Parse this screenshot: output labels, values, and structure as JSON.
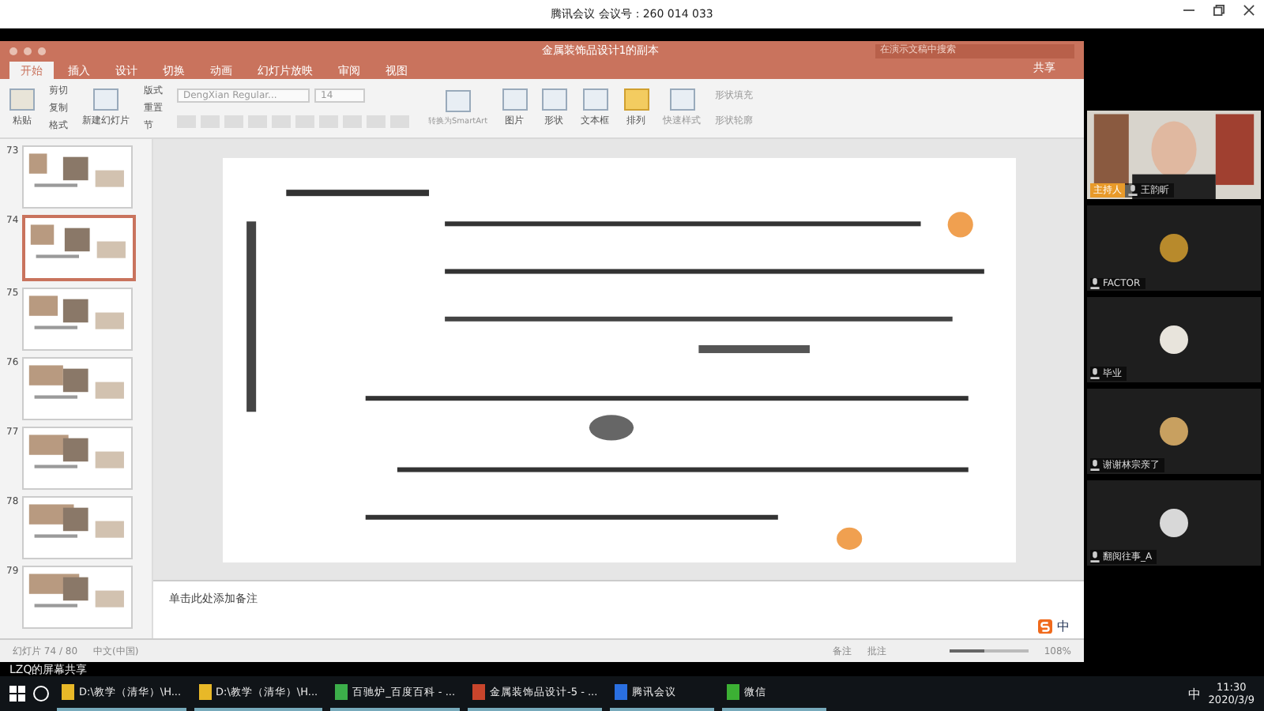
{
  "meeting_bar": {
    "title": "腾讯会议 会议号：260 014 033"
  },
  "ppt": {
    "title": "金属装饰品设计1的副本",
    "search": {
      "placeholder": "在演示文稿中搜索"
    },
    "share": "共享",
    "tabs": [
      {
        "label": "开始",
        "selected": true
      },
      {
        "label": "插入",
        "selected": false
      },
      {
        "label": "设计",
        "selected": false
      },
      {
        "label": "切换",
        "selected": false
      },
      {
        "label": "动画",
        "selected": false
      },
      {
        "label": "幻灯片放映",
        "selected": false
      },
      {
        "label": "审阅",
        "selected": false
      },
      {
        "label": "视图",
        "selected": false
      }
    ],
    "ribbon": {
      "paste": "粘贴",
      "clip": [
        "剪切",
        "复制",
        "格式"
      ],
      "new_slide": "新建幻灯片",
      "slide_opts": [
        "版式",
        "重置",
        "节"
      ],
      "font": "DengXian Regular...",
      "size": "14",
      "smartart": "转换为SmartArt",
      "insert": [
        "图片",
        "形状",
        "文本框"
      ],
      "arrange": "排列",
      "quick_style": "快速样式",
      "shape_opts": [
        "形状填充",
        "形状轮廓"
      ]
    },
    "thumbnails": [
      {
        "number": "73",
        "selected": false
      },
      {
        "number": "74",
        "selected": true
      },
      {
        "number": "75",
        "selected": false
      },
      {
        "number": "76",
        "selected": false
      },
      {
        "number": "77",
        "selected": false
      },
      {
        "number": "78",
        "selected": false
      },
      {
        "number": "79",
        "selected": false
      }
    ],
    "notes_placeholder": "单击此处添加备注",
    "status_bar": {
      "slide": "幻灯片 74 / 80",
      "language": "中文(中国)",
      "notes": "备注",
      "comments": "批注",
      "level": 0.45,
      "zoom": "108%"
    }
  },
  "share_label": "LZQ的屏幕共享",
  "participants": [
    {
      "name": "王韵昕",
      "host_badge": "主持人",
      "kind": "video"
    },
    {
      "name": "FACTOR",
      "kind": "avatar"
    },
    {
      "name": "毕业",
      "kind": "avatar"
    },
    {
      "name": "谢谢林宗亲了",
      "kind": "avatar"
    },
    {
      "name": "翻阅往事_A",
      "kind": "avatar"
    }
  ],
  "ime": "中",
  "taskbar": {
    "apps": [
      {
        "label": "D:\\教学（清华）\\H...",
        "kind": "folder"
      },
      {
        "label": "D:\\教学（清华）\\H...",
        "kind": "folder"
      },
      {
        "label": "百驰炉_百度百科 - ...",
        "kind": "browser"
      },
      {
        "label": "金属装饰品设计-5 - ...",
        "kind": "ppt"
      },
      {
        "label": "腾讯会议",
        "kind": "meeting"
      },
      {
        "label": "微信",
        "kind": "wechat"
      }
    ],
    "tray_ime": "中",
    "time": "11:30",
    "date": "2020/3/9"
  }
}
